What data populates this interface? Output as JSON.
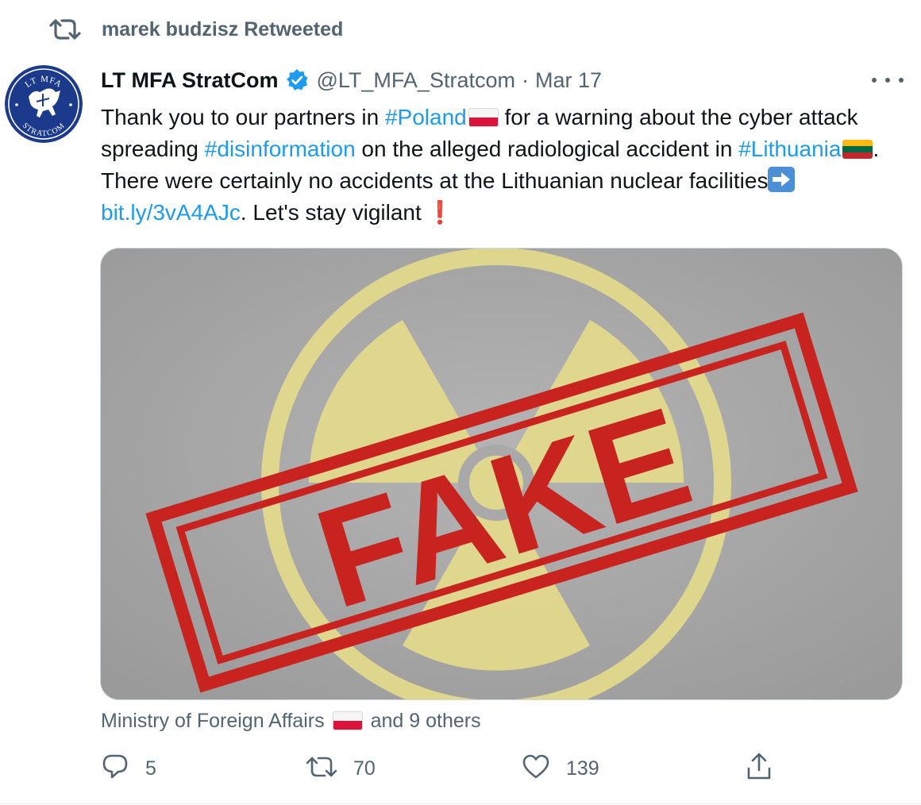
{
  "retweet": {
    "label": "marek budzisz Retweeted"
  },
  "author": {
    "display_name": "LT MFA StratCom",
    "handle": "@LT_MFA_Stratcom",
    "separator": "·",
    "date": "Mar 17",
    "avatar_text_top": "LT MFA",
    "avatar_text_bottom": "STRATCOM"
  },
  "tweet": {
    "segments": {
      "t1": "Thank you to our partners in ",
      "poland": "#Poland",
      "t2": " for a warning about the cyber attack spreading ",
      "disinfo": "#disinformation",
      "t3": " on the alleged radiological accident in ",
      "lithuania": "#Lithuania",
      "t4": ". There were certainly no accidents at the Lithuanian nuclear facilities",
      "url": "bit.ly/3vA4AJc",
      "t5": ". Let's stay vigilant",
      "excl": "❗"
    },
    "media_stamp_text": "FAKE"
  },
  "tagged": {
    "first": "Ministry of Foreign Affairs",
    "rest": "and 9 others"
  },
  "actions": {
    "replies": "5",
    "retweets": "70",
    "likes": "139"
  },
  "colors": {
    "link": "#1d9bf0",
    "muted": "#536471",
    "stamp_red": "#c8231f",
    "radiation_yellow": "#e6dc8c"
  },
  "icons": [
    "retweet-icon",
    "verified-icon",
    "more-icon",
    "reply-icon",
    "like-icon",
    "share-icon",
    "arrow-right-emoji",
    "flag-poland",
    "flag-lithuania"
  ]
}
